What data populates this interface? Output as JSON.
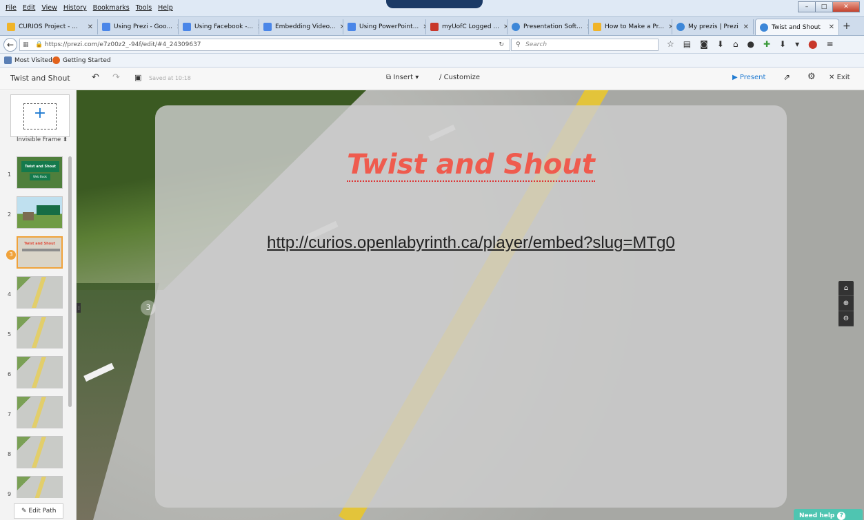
{
  "menubar": {
    "items": [
      "File",
      "Edit",
      "View",
      "History",
      "Bookmarks",
      "Tools",
      "Help"
    ]
  },
  "tabs": [
    {
      "label": "CURIOS Project - ...",
      "icon_color": "#f0b429",
      "icon": "drive-icon"
    },
    {
      "label": "Using Prezi - Goo...",
      "icon_color": "#4a86e8",
      "icon": "docs-icon"
    },
    {
      "label": "Using Facebook -...",
      "icon_color": "#4a86e8",
      "icon": "docs-icon"
    },
    {
      "label": "Embedding Video...",
      "icon_color": "#4a86e8",
      "icon": "docs-icon"
    },
    {
      "label": "Using PowerPoint...",
      "icon_color": "#4a86e8",
      "icon": "docs-icon"
    },
    {
      "label": "myUofC Logged ...",
      "icon_color": "#c8382b",
      "icon": "crest-icon"
    },
    {
      "label": "Presentation Soft...",
      "icon_color": "#3d87d8",
      "icon": "prezi-icon"
    },
    {
      "label": "How to Make a Pr...",
      "icon_color": "#f0b429",
      "icon": "wikihow-icon"
    },
    {
      "label": "My prezis | Prezi",
      "icon_color": "#3d87d8",
      "icon": "prezi-icon"
    },
    {
      "label": "Twist and Shout",
      "icon_color": "#3d87d8",
      "icon": "prezi-icon"
    }
  ],
  "navbar": {
    "url": "https://prezi.com/e7z00z2_-94f/edit/#4_24309637",
    "search_placeholder": "Search"
  },
  "bookmarks": [
    {
      "label": "Most Visited",
      "icon_color": "#5a7fb5"
    },
    {
      "label": "Getting Started",
      "icon_color": "#e2621c"
    }
  ],
  "prezibar": {
    "title": "Twist and Shout",
    "saved": "Saved at 10:18",
    "insert": "Insert",
    "customize": "Customize",
    "present": "Present",
    "exit": "Exit"
  },
  "leftpanel": {
    "frame_type": "Invisible Frame",
    "edit_path": "Edit Path",
    "slides": [
      {
        "num": "1",
        "thumb_title": "Twist and Shout",
        "thumb_sub": "Web Book"
      },
      {
        "num": "2"
      },
      {
        "num": "3",
        "thumb_title": "Twist and Shout"
      },
      {
        "num": "4"
      },
      {
        "num": "5"
      },
      {
        "num": "6"
      },
      {
        "num": "7"
      },
      {
        "num": "8"
      },
      {
        "num": "9"
      }
    ]
  },
  "canvas": {
    "step_number": "3",
    "frame_title": "Twist and Shout",
    "frame_url": "http://curios.openlabyrinth.ca/player/embed?slug=MTg0",
    "need_help": "Need help"
  },
  "colors": {
    "accent": "#1f7ad1",
    "title_red": "#ef5b4e",
    "active_step": "#f0a23a",
    "help_teal": "#4fc5b1"
  }
}
